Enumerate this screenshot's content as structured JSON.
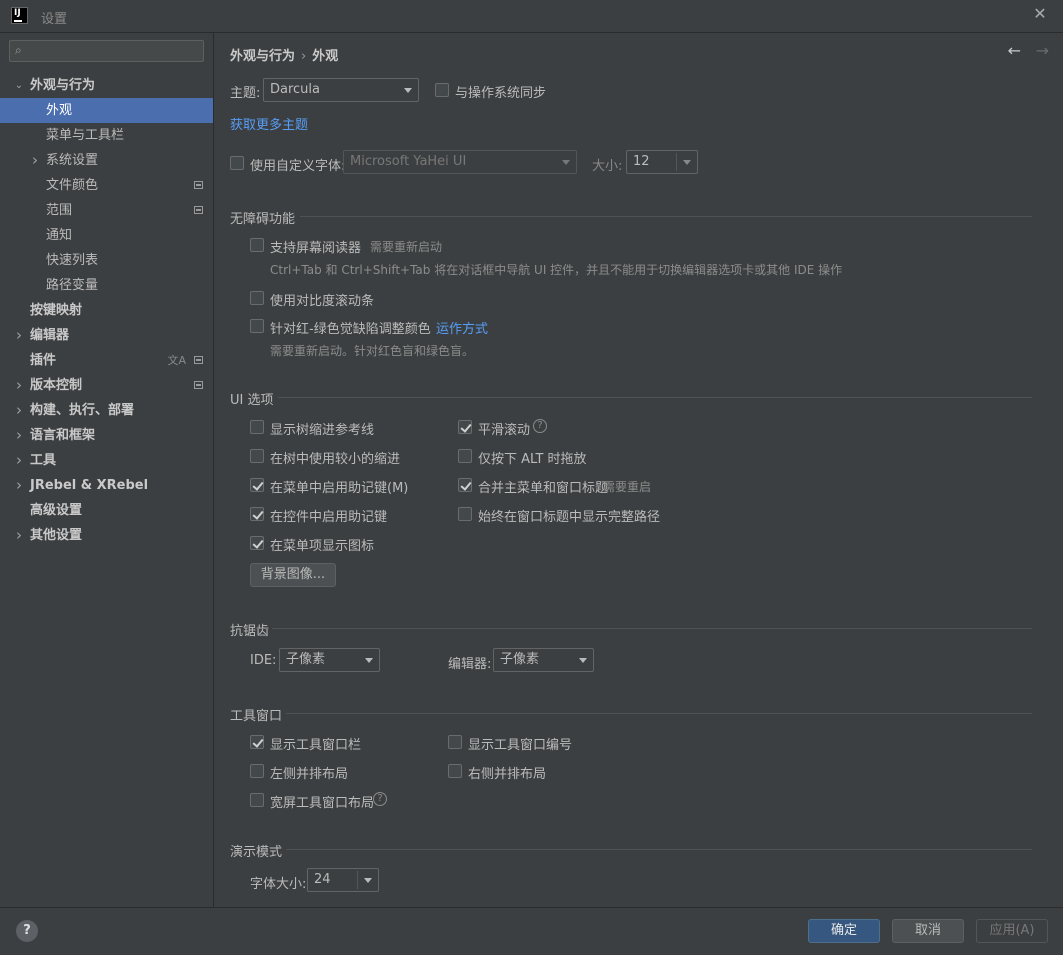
{
  "window": {
    "title": "设置",
    "close": "✕"
  },
  "search": {
    "placeholder": ""
  },
  "tree": [
    {
      "label": "外观与行为",
      "level": 0,
      "arrow": "expanded",
      "bold": true
    },
    {
      "label": "外观",
      "level": 1,
      "selected": true
    },
    {
      "label": "菜单与工具栏",
      "level": 1
    },
    {
      "label": "系统设置",
      "level": 1,
      "arrow": "collapsed"
    },
    {
      "label": "文件颜色",
      "level": 1,
      "badge": true
    },
    {
      "label": "范围",
      "level": 1,
      "badge": true
    },
    {
      "label": "通知",
      "level": 1
    },
    {
      "label": "快速列表",
      "level": 1
    },
    {
      "label": "路径变量",
      "level": 1
    },
    {
      "label": "按键映射",
      "level": 0,
      "bold": true
    },
    {
      "label": "编辑器",
      "level": 0,
      "arrow": "collapsed",
      "bold": true
    },
    {
      "label": "插件",
      "level": 0,
      "bold": true,
      "badge": true,
      "lang": true
    },
    {
      "label": "版本控制",
      "level": 0,
      "arrow": "collapsed",
      "bold": true,
      "badge": true
    },
    {
      "label": "构建、执行、部署",
      "level": 0,
      "arrow": "collapsed",
      "bold": true
    },
    {
      "label": "语言和框架",
      "level": 0,
      "arrow": "collapsed",
      "bold": true
    },
    {
      "label": "工具",
      "level": 0,
      "arrow": "collapsed",
      "bold": true
    },
    {
      "label": "JRebel & XRebel",
      "level": 0,
      "arrow": "collapsed",
      "bold": true
    },
    {
      "label": "高级设置",
      "level": 0,
      "bold": true
    },
    {
      "label": "其他设置",
      "level": 0,
      "arrow": "collapsed",
      "bold": true
    }
  ],
  "breadcrumb": {
    "parent": "外观与行为",
    "sep": "›",
    "current": "外观"
  },
  "theme": {
    "label": "主题:",
    "value": "Darcula",
    "sync_label": "与操作系统同步",
    "sync": false,
    "more_link": "获取更多主题"
  },
  "font": {
    "custom_label": "使用自定义字体:",
    "custom": false,
    "family": "Microsoft YaHei UI",
    "size_label": "大小:",
    "size": "12"
  },
  "accessibility": {
    "title": "无障碍功能",
    "screen_reader": "支持屏幕阅读器",
    "screen_reader_hint": "需要重新启动",
    "screen_reader_desc": "Ctrl+Tab 和 Ctrl+Shift+Tab 将在对话框中导航 UI 控件，并且不能用于切换编辑器选项卡或其他 IDE 操作",
    "contrast_scroll": "使用对比度滚动条",
    "color_blind": "针对红-绿色觉缺陷调整颜色",
    "how_it_works": "运作方式",
    "color_blind_desc": "需要重新启动。针对红色盲和绿色盲。"
  },
  "ui_options": {
    "title": "UI 选项",
    "tree_guides": "显示树缩进参考线",
    "smaller_indent": "在树中使用较小的缩进",
    "menu_mnemonics": "在菜单中启用助记键(M)",
    "control_mnemonics": "在控件中启用助记键",
    "menu_icons": "在菜单项显示图标",
    "smooth_scroll": "平滑滚动",
    "alt_drag": "仅按下 ALT 时拖放",
    "merge_menu": "合并主菜单和窗口标题",
    "merge_menu_hint": "需要重启",
    "full_path": "始终在窗口标题中显示完整路径",
    "background_btn": "背景图像..."
  },
  "antialias": {
    "title": "抗锯齿",
    "ide_label": "IDE:",
    "ide_value": "子像素",
    "editor_label": "编辑器:",
    "editor_value": "子像素"
  },
  "tool_windows": {
    "title": "工具窗口",
    "show_bar": "显示工具窗口栏",
    "show_numbers": "显示工具窗口编号",
    "left_layout": "左侧并排布局",
    "right_layout": "右侧并排布局",
    "wide_layout": "宽屏工具窗口布局"
  },
  "presentation": {
    "title": "演示模式",
    "font_size_label": "字体大小:",
    "font_size": "24"
  },
  "footer": {
    "help": "?",
    "ok": "确定",
    "cancel": "取消",
    "apply": "应用(A)"
  },
  "icons": {
    "back": "←",
    "forward": "→",
    "search": "search-icon",
    "help": "?"
  }
}
